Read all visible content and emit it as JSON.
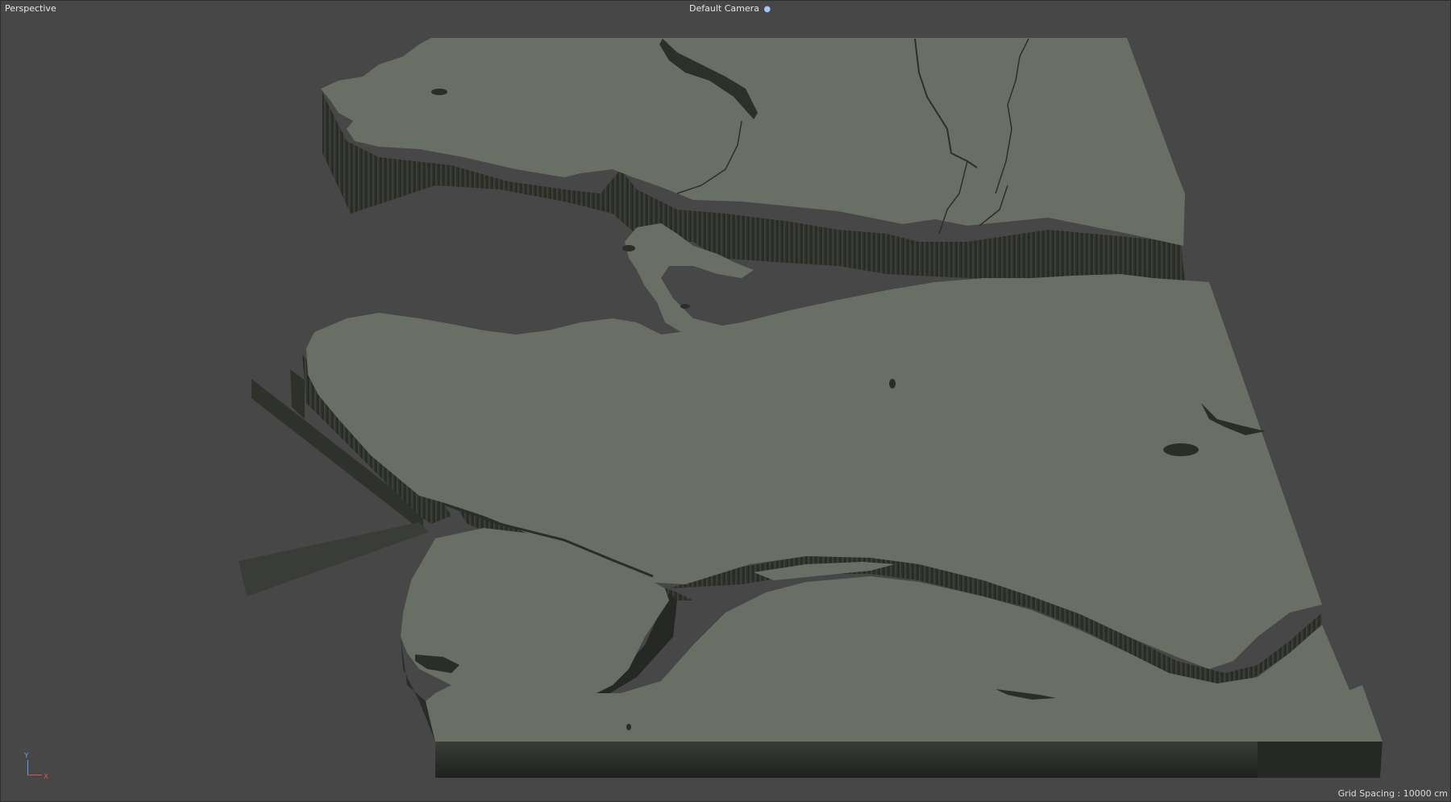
{
  "viewport": {
    "view_label": "Perspective",
    "camera_label": "Default Camera",
    "camera_icon": "camera-switch-icon",
    "grid_spacing": "Grid Spacing : 10000 cm",
    "axis_y": "Y",
    "axis_x": "X"
  },
  "colors": {
    "background": "#474747",
    "terrain_top": "#6a6f66",
    "terrain_side": "#2d302b",
    "axis_y": "#5aa0ff",
    "axis_x": "#e05050"
  }
}
